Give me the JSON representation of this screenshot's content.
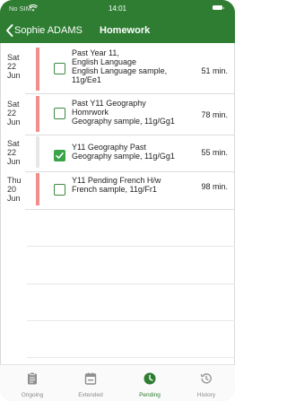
{
  "status_bar": {
    "carrier": "No SIM",
    "time": "14:01"
  },
  "nav": {
    "back_label": "Sophie ADAMS",
    "title": "Homework"
  },
  "rows": [
    {
      "day": "Sat",
      "date": "22",
      "month": "Jun",
      "title_lines": [
        "Past Year 11,",
        "English Language"
      ],
      "subtitle_lines": [
        "English Language sample,",
        "11g/Ee1"
      ],
      "duration": "51 min.",
      "checked": false
    },
    {
      "day": "Sat",
      "date": "22",
      "month": "Jun",
      "title_lines": [
        "Past Y11 Geography",
        "Homrwork"
      ],
      "subtitle_lines": [
        "Geography sample, 11g/Gg1"
      ],
      "duration": "78 min.",
      "checked": false
    },
    {
      "day": "Sat",
      "date": "22",
      "month": "Jun",
      "title_lines": [
        "Y11 Geography Past"
      ],
      "subtitle_lines": [
        "Geography sample, 11g/Gg1"
      ],
      "duration": "55 min.",
      "checked": true
    },
    {
      "day": "Thu",
      "date": "20",
      "month": "Jun",
      "title_lines": [
        "Y11 Pending French H/w"
      ],
      "subtitle_lines": [
        "French sample, 11g/Fr1"
      ],
      "duration": "98 min.",
      "checked": false
    }
  ],
  "tabs": [
    {
      "label": "Ongoing",
      "icon": "clipboard-icon",
      "active": false
    },
    {
      "label": "Extended",
      "icon": "calendar-icon",
      "active": false
    },
    {
      "label": "Pending",
      "icon": "clock-icon",
      "active": true
    },
    {
      "label": "History",
      "icon": "history-icon",
      "active": false
    }
  ],
  "colors": {
    "header_green": "#2e7d32",
    "accent_pink": "#f28d8d",
    "check_green": "#3aa44a"
  }
}
